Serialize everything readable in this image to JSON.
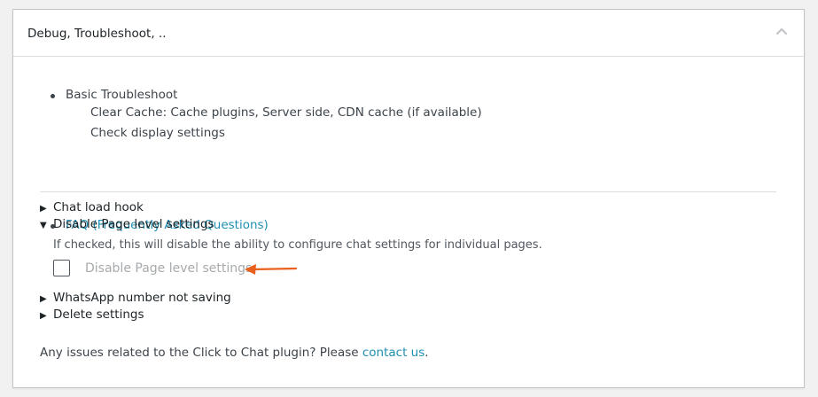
{
  "panel": {
    "title": "Debug, Troubleshoot, ..",
    "collapse_icon": "chevron-up-icon"
  },
  "troubleshoot": {
    "heading": "Basic Troubleshoot",
    "items": [
      "Clear Cache: Cache plugins, Server side, CDN cache (if available)",
      "Check display settings"
    ],
    "faq_link": "FAQ (Frequently Asked Questions)"
  },
  "accordions": [
    {
      "label": "Chat load hook",
      "expanded": false
    },
    {
      "label": "Disable Page level settings",
      "expanded": true
    },
    {
      "label": "WhatsApp number not saving",
      "expanded": false
    },
    {
      "label": "Delete settings",
      "expanded": false
    }
  ],
  "disable_page_settings": {
    "description": "If checked, this will disable the ability to configure chat settings for individual pages.",
    "checkbox_label": "Disable Page level settings",
    "checked": false
  },
  "footer": {
    "text_before": "Any issues related to the Click to Chat plugin? Please ",
    "link": "contact us",
    "text_after": "."
  },
  "colors": {
    "link": "#1f8fb2",
    "arrow": "#e8601c",
    "muted_label": "#a7aaad"
  },
  "icons": {
    "collapsed": "triangle-right-icon",
    "expanded": "triangle-down-icon"
  }
}
